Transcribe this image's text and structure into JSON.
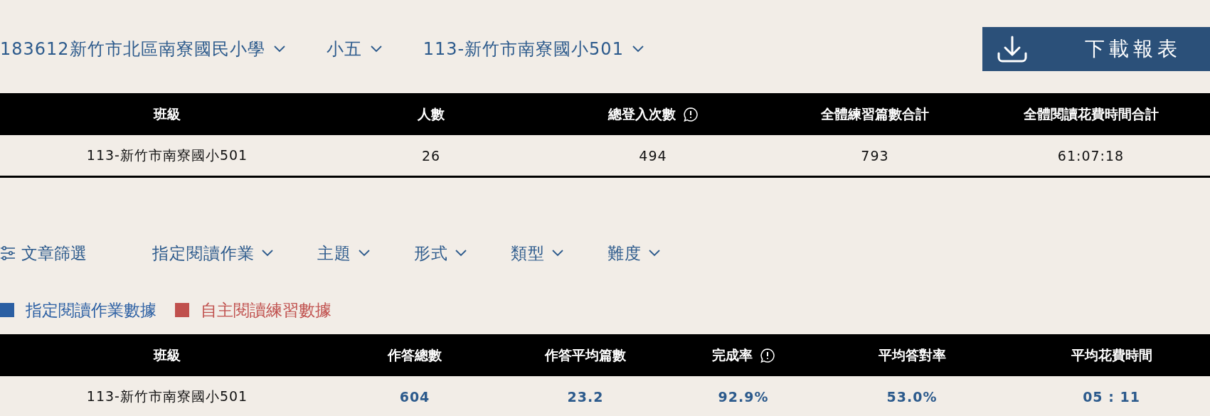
{
  "selectors": [
    {
      "label": "183612新竹市北區南寮國民小學"
    },
    {
      "label": "小五"
    },
    {
      "label": "113-新竹市南寮國小501"
    }
  ],
  "download_button": {
    "label": "下載報表"
  },
  "summary_table": {
    "columns": [
      {
        "label": "班級",
        "kind": "plain"
      },
      {
        "label": "人數",
        "kind": "plain"
      },
      {
        "label": "總登入次數",
        "kind": "info"
      },
      {
        "label": "全體練習篇數合計",
        "kind": "plain"
      },
      {
        "label": "全體閱讀花費時間合計",
        "kind": "plain"
      }
    ],
    "rows": [
      [
        "113-新竹市南寮國小501",
        "26",
        "494",
        "793",
        "61:07:18"
      ]
    ]
  },
  "filter": {
    "label": "文章篩選",
    "dropdowns": [
      {
        "label": "指定閱讀作業"
      },
      {
        "label": "主題"
      },
      {
        "label": "形式"
      },
      {
        "label": "類型"
      },
      {
        "label": "難度"
      }
    ]
  },
  "legend": [
    {
      "label": "指定閱讀作業數據",
      "color": "#2b5fa3"
    },
    {
      "label": "自主閱讀練習數據",
      "color": "#c0504d"
    }
  ],
  "stats_table": {
    "columns": [
      {
        "label": "班級",
        "kind": "plain"
      },
      {
        "label": "作答總數",
        "kind": "plain"
      },
      {
        "label": "作答平均篇數",
        "kind": "plain"
      },
      {
        "label": "完成率",
        "kind": "info"
      },
      {
        "label": "平均答對率",
        "kind": "plain"
      },
      {
        "label": "平均花費時間",
        "kind": "plain"
      }
    ],
    "rows": [
      [
        "113-新竹市南寮國小501",
        "604",
        "23.2",
        "92.9%",
        "53.0%",
        "05 : 11"
      ]
    ]
  }
}
